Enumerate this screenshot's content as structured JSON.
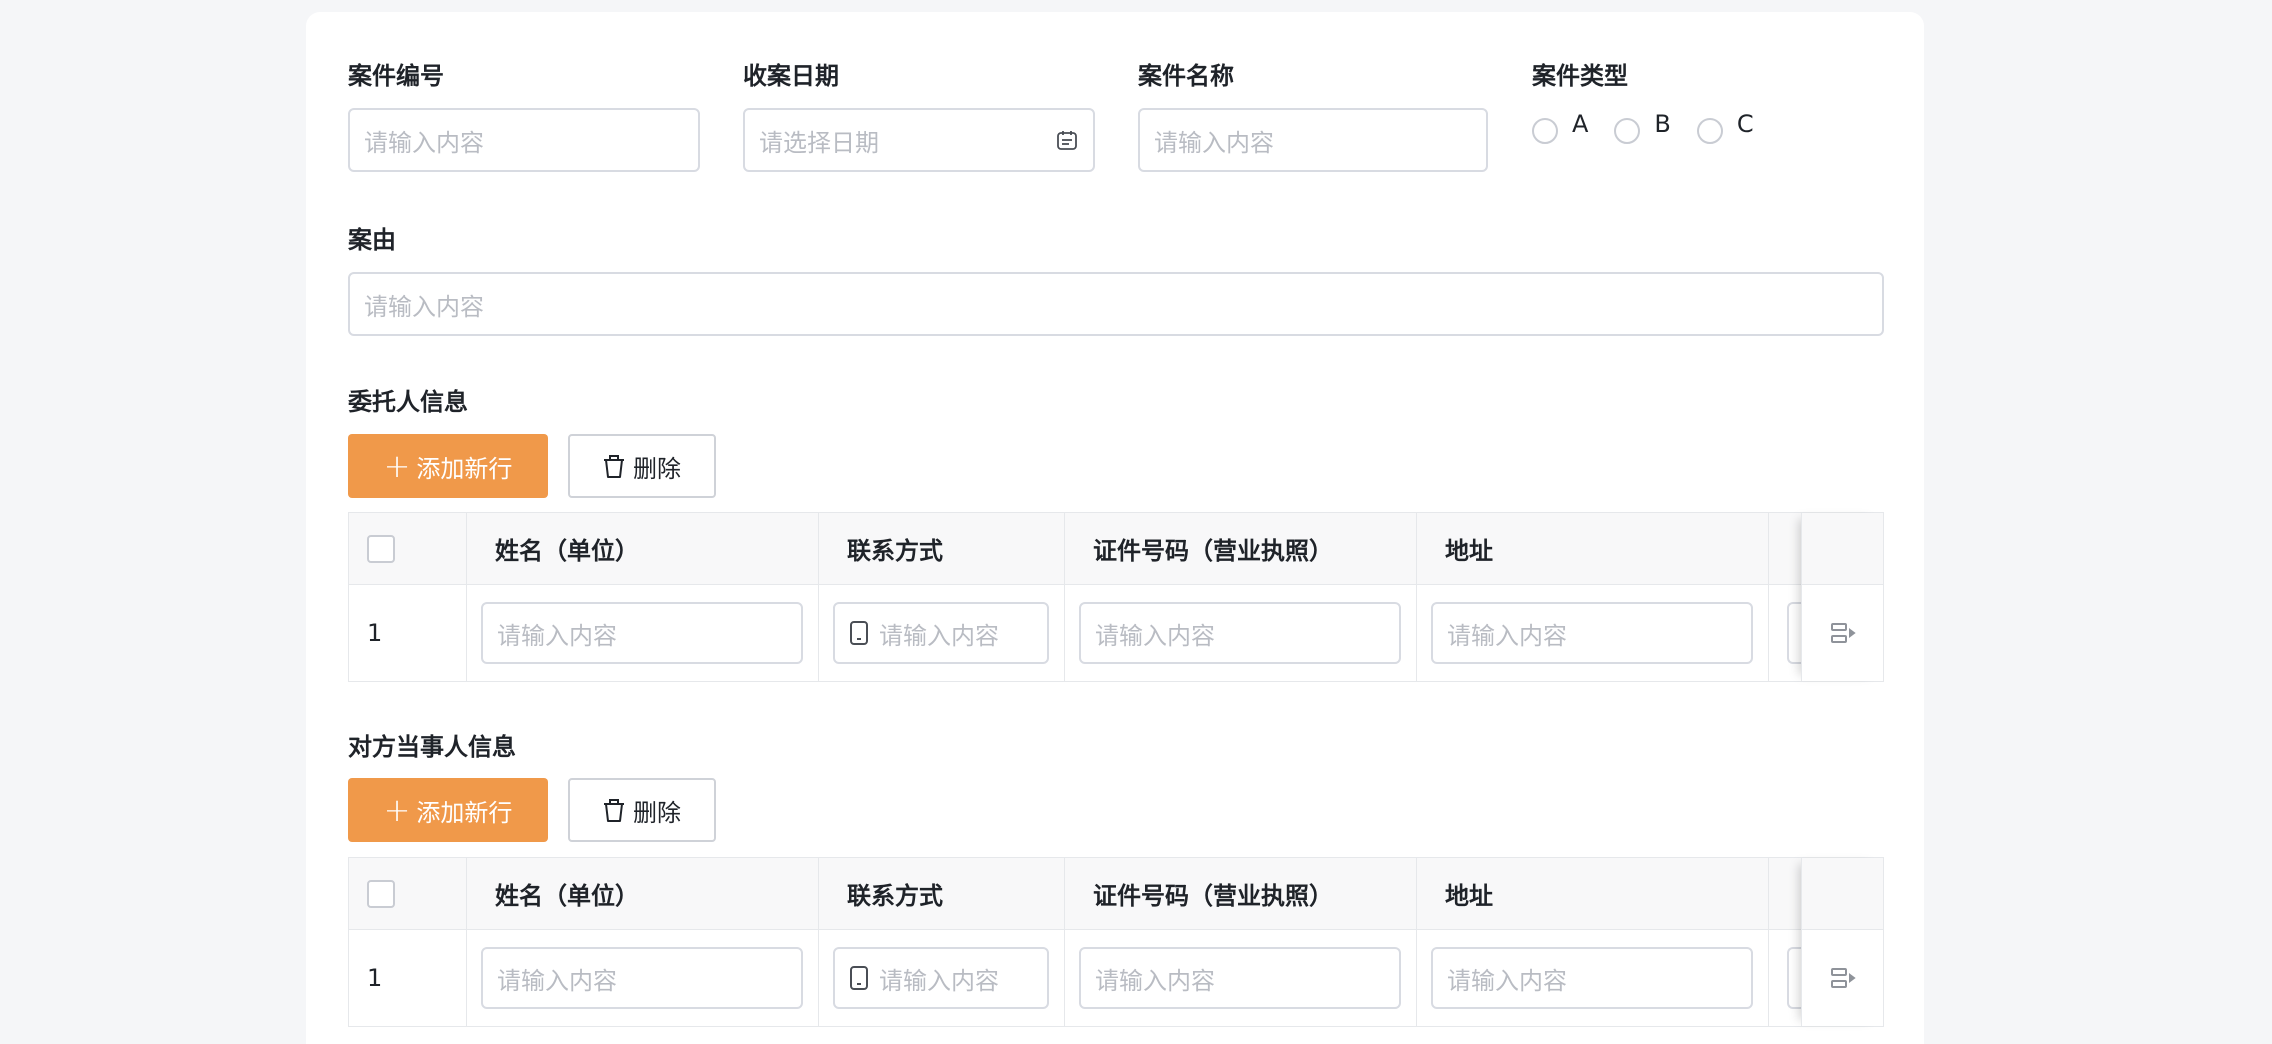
{
  "form": {
    "case_no": {
      "label": "案件编号",
      "placeholder": "请输入内容"
    },
    "receive_date": {
      "label": "收案日期",
      "placeholder": "请选择日期"
    },
    "case_name": {
      "label": "案件名称",
      "placeholder": "请输入内容"
    },
    "case_type": {
      "label": "案件类型",
      "options": [
        "A",
        "B",
        "C"
      ]
    },
    "case_cause": {
      "label": "案由",
      "placeholder": "请输入内容"
    }
  },
  "client_section": {
    "title": "委托人信息",
    "add_label": "添加新行",
    "delete_label": "删除",
    "columns": [
      "姓名（单位）",
      "联系方式",
      "证件号码（营业执照）",
      "地址"
    ],
    "rows": [
      {
        "index": "1",
        "name_ph": "请输入内容",
        "contact_ph": "请输入内容",
        "id_ph": "请输入内容",
        "address_ph": "请输入内容"
      }
    ]
  },
  "opponent_section": {
    "title": "对方当事人信息",
    "add_label": "添加新行",
    "delete_label": "删除",
    "columns": [
      "姓名（单位）",
      "联系方式",
      "证件号码（营业执照）",
      "地址"
    ],
    "rows": [
      {
        "index": "1",
        "name_ph": "请输入内容",
        "contact_ph": "请输入内容",
        "id_ph": "请输入内容",
        "address_ph": "请输入内容"
      }
    ]
  },
  "icons": {
    "date": "calendar-icon",
    "delete": "trash-icon",
    "add": "plus-icon",
    "contact": "phone-icon",
    "row_action": "row-action-icon"
  },
  "colors": {
    "primary": "#f0994a",
    "border": "#d8dbe2",
    "placeholder": "#b9bcc3"
  }
}
